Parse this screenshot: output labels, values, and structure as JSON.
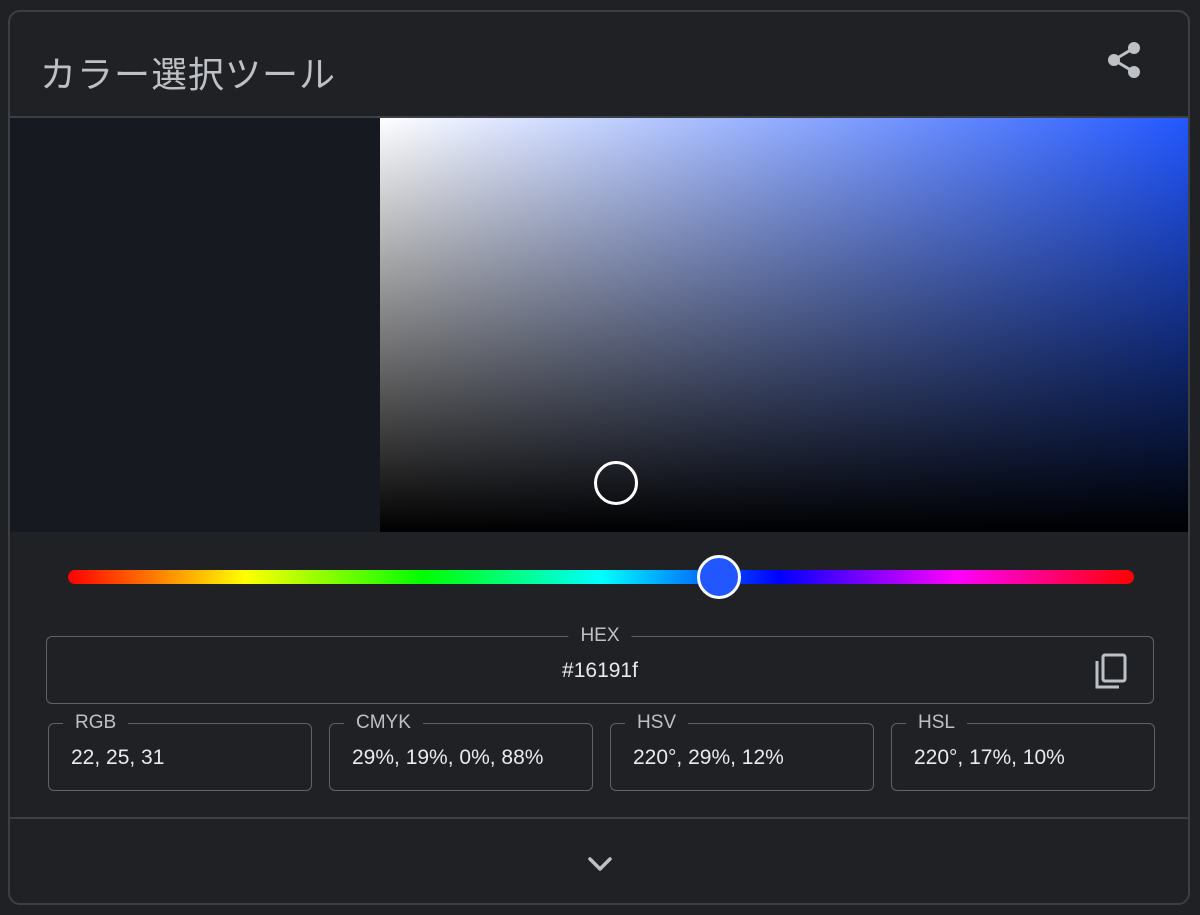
{
  "title": "カラー選択ツール",
  "selected_color": "#16191f",
  "hue_color": "#2257ff",
  "hue_degrees": 220,
  "saturation_fraction": 0.29,
  "value_fraction": 0.12,
  "hex": {
    "label": "HEX",
    "value": "#16191f"
  },
  "formats": [
    {
      "label": "RGB",
      "value": "22, 25, 31"
    },
    {
      "label": "CMYK",
      "value": "29%, 19%, 0%, 88%"
    },
    {
      "label": "HSV",
      "value": "220°, 29%, 12%"
    },
    {
      "label": "HSL",
      "value": "220°, 17%, 10%"
    }
  ],
  "icons": {
    "share": "share-icon",
    "copy": "copy-icon",
    "expand": "chevron-down-icon"
  }
}
